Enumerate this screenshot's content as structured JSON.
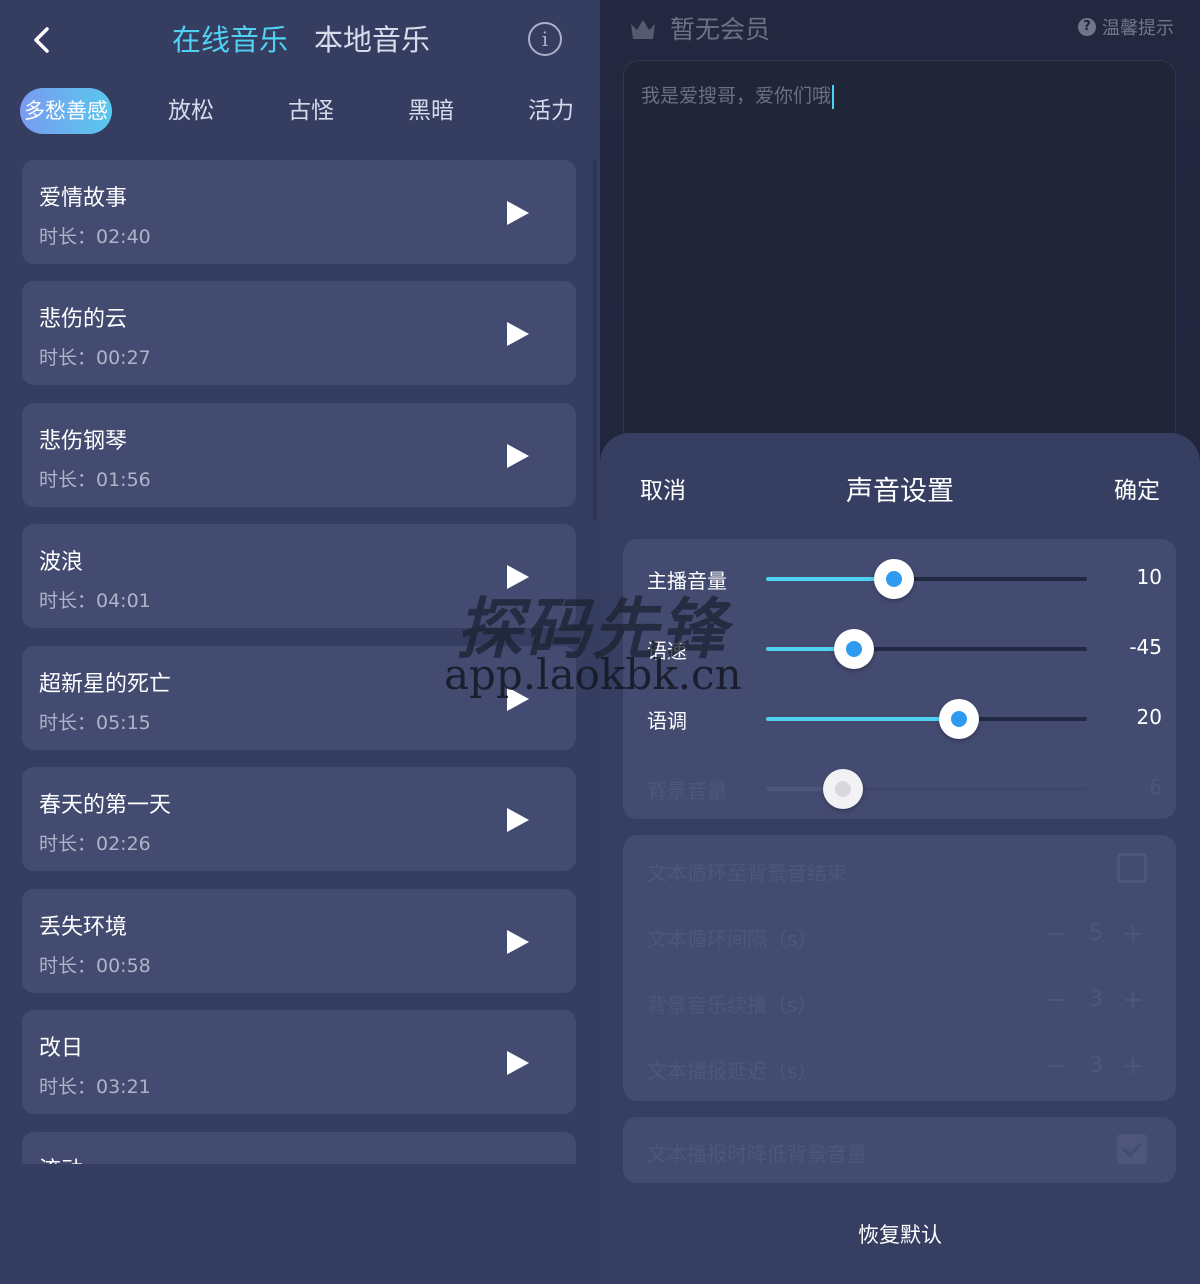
{
  "header": {
    "tabs": [
      {
        "label": "在线音乐",
        "active": true
      },
      {
        "label": "本地音乐",
        "active": false
      }
    ],
    "back_icon": "chevron-left-icon",
    "info_icon": "info-icon",
    "info_glyph": "i"
  },
  "categories": [
    "多愁善感",
    "放松",
    "古怪",
    "黑暗",
    "活力"
  ],
  "songs": [
    {
      "title": "爱情故事",
      "duration": "时长：02:40"
    },
    {
      "title": "悲伤的云",
      "duration": "时长：00:27"
    },
    {
      "title": "悲伤钢琴",
      "duration": "时长：01:56"
    },
    {
      "title": "波浪",
      "duration": "时长：04:01"
    },
    {
      "title": "超新星的死亡",
      "duration": "时长：05:15"
    },
    {
      "title": "春天的第一天",
      "duration": "时长：02:26"
    },
    {
      "title": "丢失环境",
      "duration": "时长：00:58"
    },
    {
      "title": "改日",
      "duration": "时长：03:21"
    },
    {
      "title": "流动",
      "duration": ""
    }
  ],
  "right_header": {
    "vip_text": "暂无会员",
    "tip_text": "温馨提示",
    "help_glyph": "?",
    "text_content": "我是爱搜哥，爱你们哦"
  },
  "sheet": {
    "cancel": "取消",
    "title": "声音设置",
    "confirm": "确定",
    "sliders": [
      {
        "label": "主播音量",
        "value": "10",
        "fraction": 0.4
      },
      {
        "label": "语速",
        "value": "-45",
        "fraction": 0.275
      },
      {
        "label": "语调",
        "value": "20",
        "fraction": 0.6
      },
      {
        "label": "背景音量",
        "value": "6",
        "fraction": 0.24
      }
    ],
    "options": {
      "loop_to_bg_end": {
        "label": "文本循环至背景音结束",
        "checked": false
      },
      "loop_interval": {
        "label": "文本循环间隔（s）",
        "value": "5"
      },
      "bg_continue": {
        "label": "背景音乐续播（s）",
        "value": "3"
      },
      "broadcast_delay": {
        "label": "文本播报延迟（s）",
        "value": "3"
      },
      "lower_bg_volume": {
        "label": "文本播报时降低背景音量",
        "checked": true
      }
    },
    "stepper_minus": "−",
    "stepper_plus": "+",
    "restore": "恢复默认"
  },
  "watermark": {
    "line1": "探码先锋",
    "line2": "app.laokbk.cn"
  },
  "colors": {
    "accent": "#4fd2f2",
    "knob_center": "#2e9bf0",
    "card_bg": "#434b71",
    "panel_bg": "#353d61"
  }
}
